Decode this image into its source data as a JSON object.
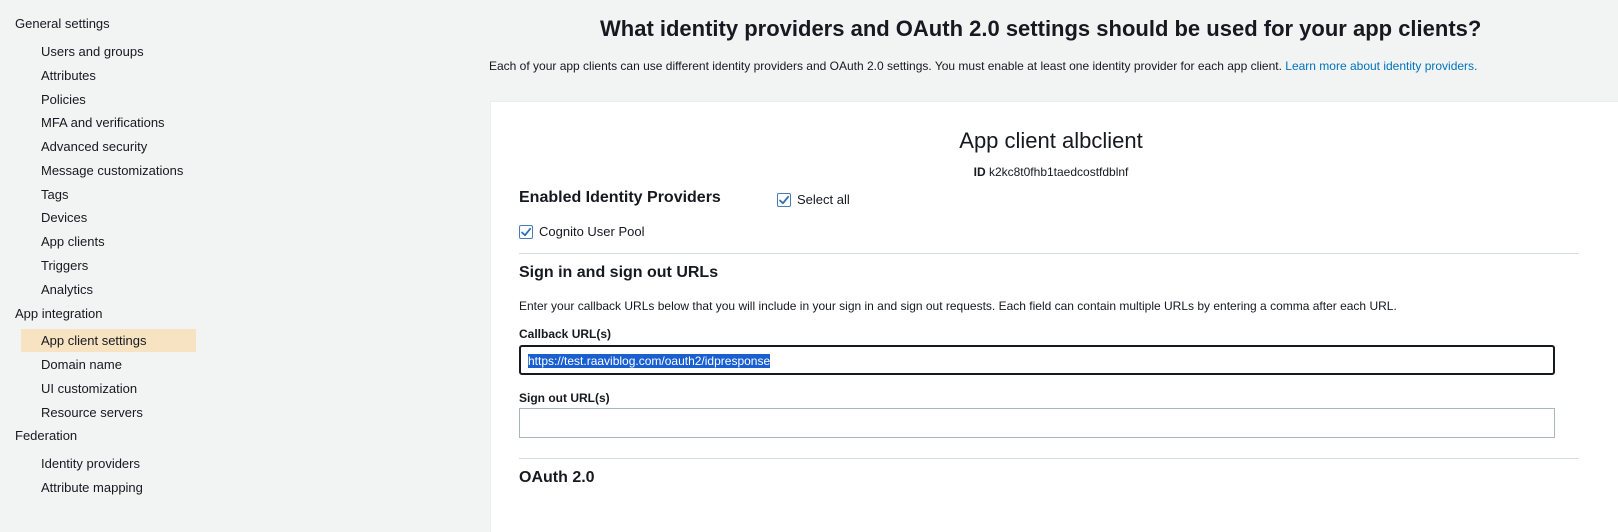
{
  "sidebar": {
    "general_settings": "General settings",
    "general_items": [
      "Users and groups",
      "Attributes",
      "Policies",
      "MFA and verifications",
      "Advanced security",
      "Message customizations",
      "Tags",
      "Devices",
      "App clients",
      "Triggers",
      "Analytics"
    ],
    "app_integration": "App integration",
    "app_integration_items": [
      "App client settings",
      "Domain name",
      "UI customization",
      "Resource servers"
    ],
    "federation": "Federation",
    "federation_items": [
      "Identity providers",
      "Attribute mapping"
    ]
  },
  "main": {
    "heading": "What identity providers and OAuth 2.0 settings should be used for your app clients?",
    "description": "Each of your app clients can use different identity providers and OAuth 2.0 settings. You must enable at least one identity provider for each app client.",
    "description_link": "Learn more about identity providers.",
    "app_client": {
      "title": "App client albclient",
      "id_label": "ID",
      "id_value": "k2kc8t0fhb1taedcostfdblnf"
    },
    "enabled_idps": {
      "title": "Enabled Identity Providers",
      "select_all_label": "Select all",
      "select_all_checked": true,
      "cognito_label": "Cognito User Pool",
      "cognito_checked": true
    },
    "urls": {
      "title": "Sign in and sign out URLs",
      "helper": "Enter your callback URLs below that you will include in your sign in and sign out requests. Each field can contain multiple URLs by entering a comma after each URL.",
      "callback_label": "Callback URL(s)",
      "callback_value": "https://test.raaviblog.com/oauth2/idpresponse",
      "signout_label": "Sign out URL(s)",
      "signout_value": ""
    },
    "oauth": {
      "title": "OAuth 2.0"
    }
  },
  "colors": {
    "accent_link": "#0073bb",
    "active_nav": "#f7e3c2",
    "checkbox_border": "#4a7bb4",
    "checkmark": "#2c6fb7",
    "selection": "#1a5fd0"
  }
}
